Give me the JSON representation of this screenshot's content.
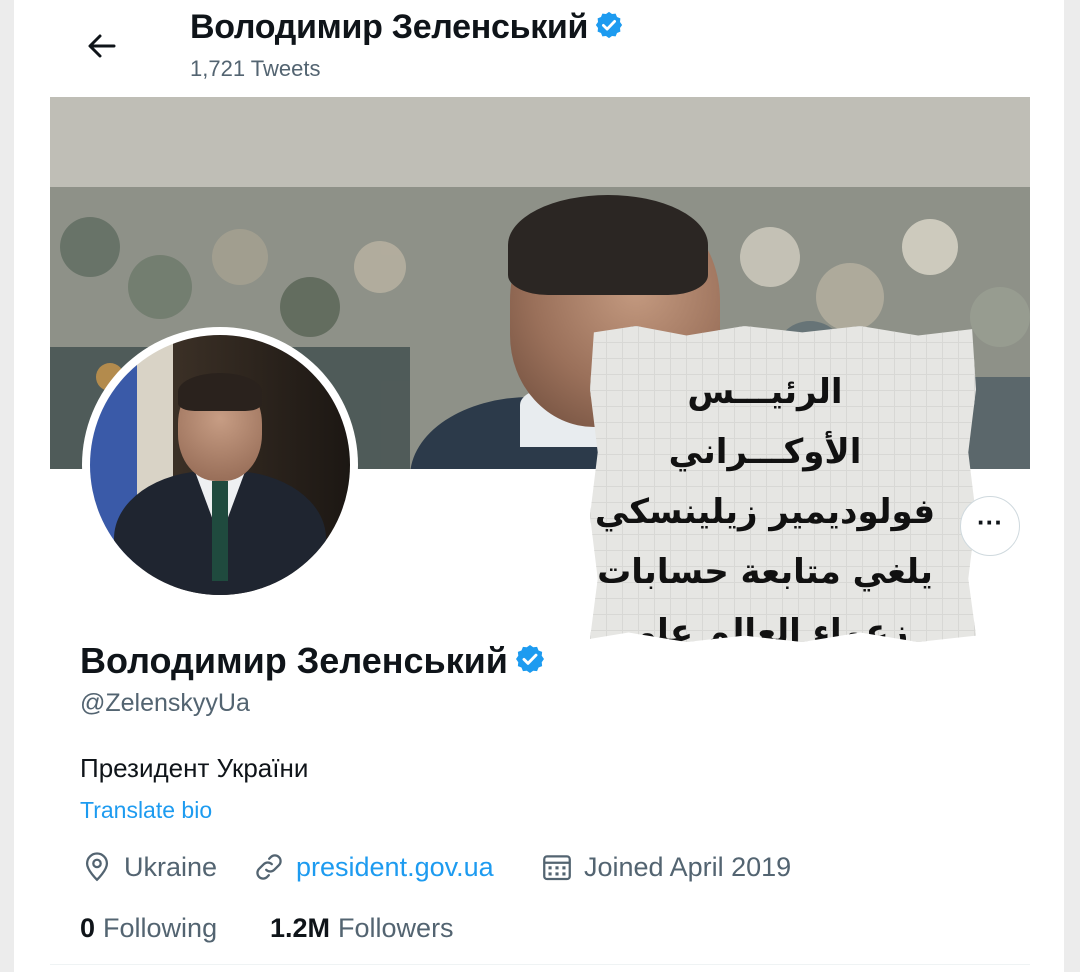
{
  "header": {
    "name": "Володимир Зеленський",
    "tweets_count": "1,721 Tweets",
    "back_icon": "arrow-left-icon"
  },
  "banner": {
    "overlay_lines": [
      "الرئيـــس الأوكـــراني",
      "فولوديمير زيلينسكي",
      "يلغي متابعة حسابات",
      "زعماء العالم على تويتر"
    ]
  },
  "profile": {
    "name": "Володимир Зеленський",
    "verified_icon": "verified-badge-icon",
    "handle": "@ZelenskyyUa",
    "bio": "Президент України",
    "translate_label": "Translate bio",
    "more_label": "···",
    "location": "Ukraine",
    "website": "president.gov.ua",
    "joined": "Joined April 2019",
    "following_count": "0",
    "following_label": "Following",
    "followers_count": "1.2M",
    "followers_label": "Followers"
  },
  "colors": {
    "accent": "#1d9bf0",
    "secondary_text": "#536471",
    "primary_text": "#0f1419"
  }
}
